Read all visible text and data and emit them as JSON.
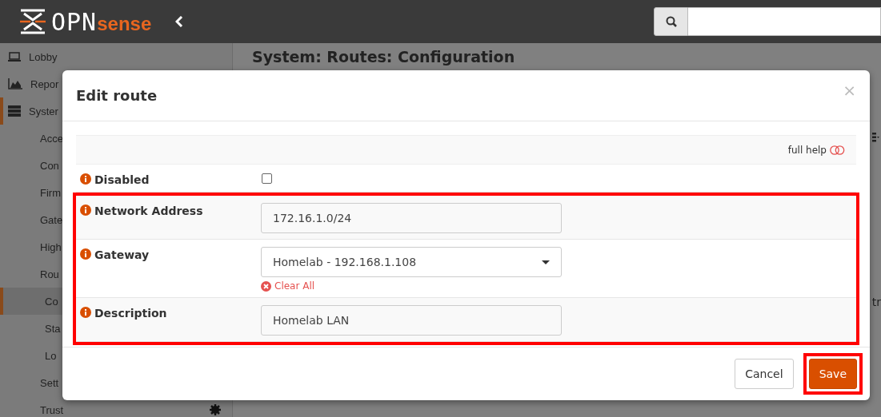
{
  "topbar": {
    "logo": {
      "main": "OPN",
      "accent": "sense"
    }
  },
  "sidebar": {
    "items": [
      {
        "label": "Lobby",
        "selected": false
      },
      {
        "label": "Repor",
        "selected": false
      },
      {
        "label": "Syster",
        "selected": true,
        "children": [
          {
            "label": "Acce",
            "selected": false
          },
          {
            "label": "Con",
            "selected": false
          },
          {
            "label": "Firm",
            "selected": false
          },
          {
            "label": "Gate",
            "selected": false
          },
          {
            "label": "High",
            "selected": false
          },
          {
            "label": "Rou",
            "selected": false,
            "children": [
              {
                "label": "Co",
                "selected": true
              },
              {
                "label": "Sta",
                "selected": false
              },
              {
                "label": "Lo",
                "selected": false
              }
            ]
          },
          {
            "label": "Sett",
            "selected": false
          },
          {
            "label": "Trust",
            "selected": false,
            "badge_icon": true
          }
        ]
      }
    ]
  },
  "page": {
    "title": "System: Routes: Configuration",
    "fragment": "tr"
  },
  "modal": {
    "title": "Edit route",
    "close": "×",
    "help_toggle": {
      "label": "full help",
      "on": false
    },
    "fields": [
      {
        "kind": "checkbox",
        "label": "Disabled",
        "checked": false,
        "highlighted": false
      },
      {
        "kind": "text",
        "label": "Network Address",
        "value": "172.16.1.0/24",
        "highlighted": true
      },
      {
        "kind": "select",
        "label": "Gateway",
        "value": "Homelab - 192.168.1.108",
        "clear_link": "Clear All",
        "highlighted": true
      },
      {
        "kind": "text",
        "label": "Description",
        "value": "Homelab LAN",
        "highlighted": true
      }
    ],
    "buttons": [
      {
        "label": "Cancel",
        "kind": "default",
        "highlighted": false
      },
      {
        "label": "Save",
        "kind": "primary",
        "highlighted": true
      }
    ]
  }
}
